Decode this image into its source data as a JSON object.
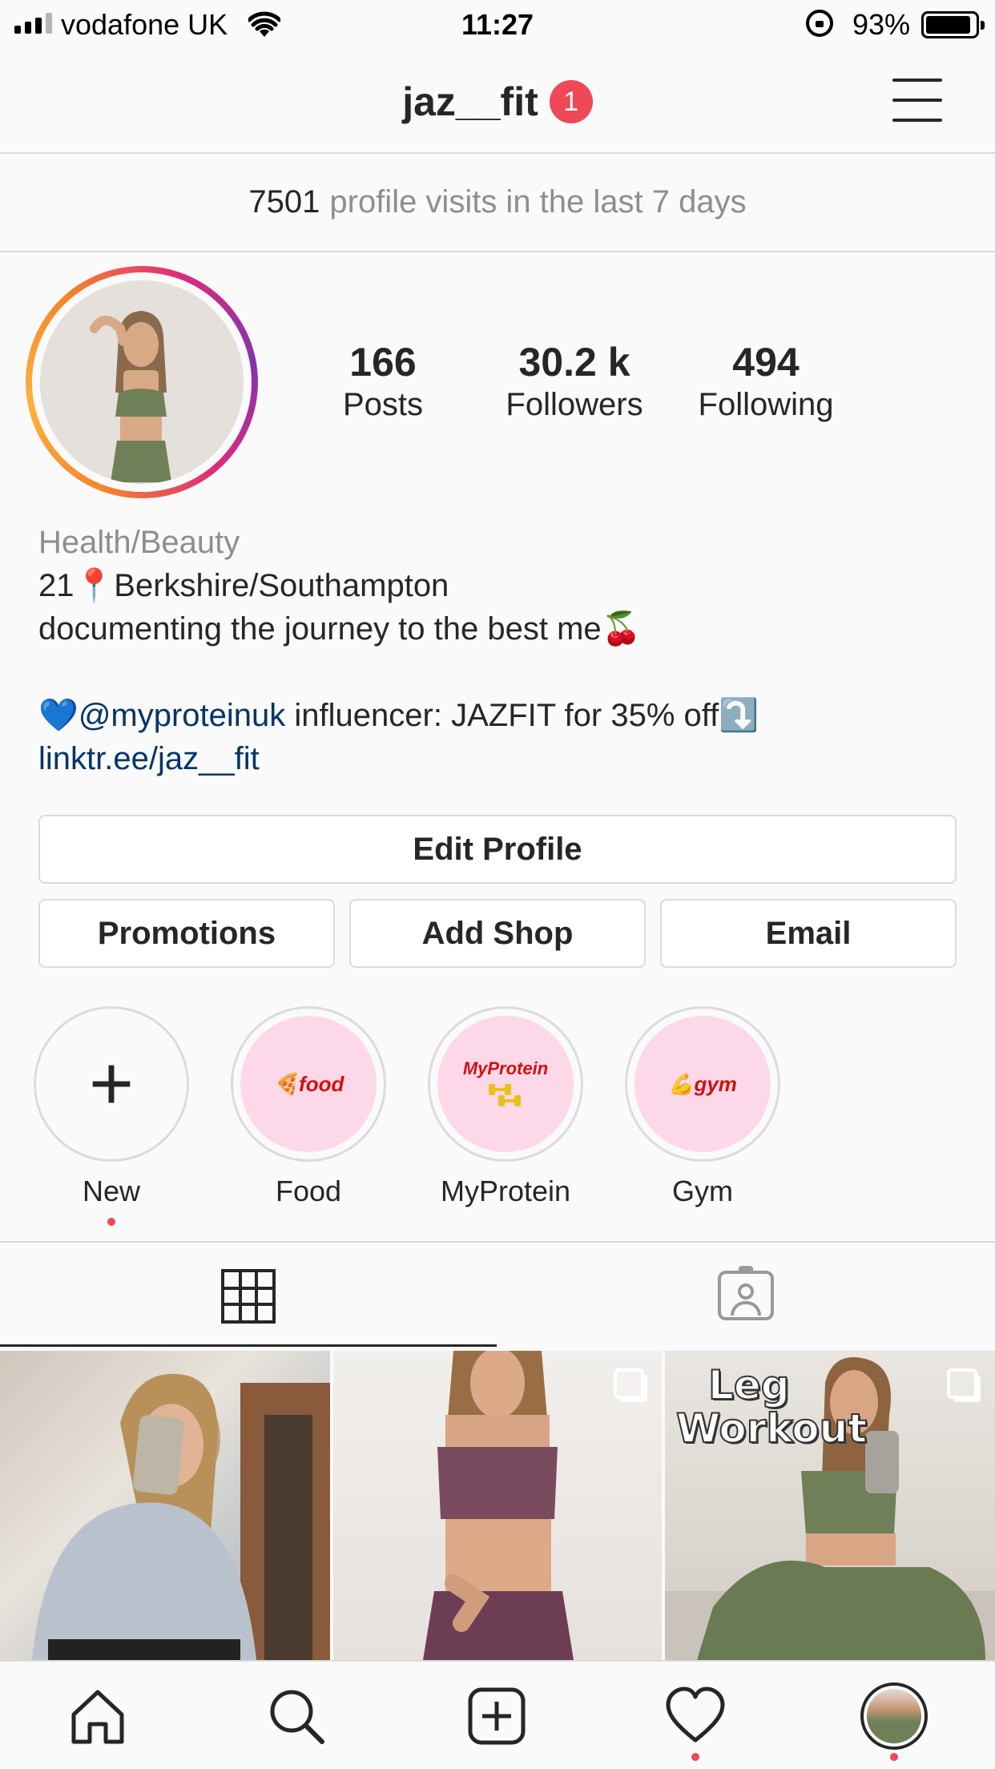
{
  "status_bar": {
    "carrier": "vodafone UK",
    "time": "11:27",
    "battery_percent": "93%",
    "battery_level": 0.93
  },
  "header": {
    "username": "jaz__fit",
    "notification_count": "1"
  },
  "visits_banner": {
    "count": "7501",
    "text": "profile visits in the last 7 days"
  },
  "profile": {
    "stats": [
      {
        "value": "166",
        "label": "Posts"
      },
      {
        "value": "30.2 k",
        "label": "Followers"
      },
      {
        "value": "494",
        "label": "Following"
      }
    ],
    "category": "Health/Beauty",
    "bio_line1": "21📍Berkshire/Southampton",
    "bio_line2": "documenting the journey to the best me🍒",
    "bio_line3_prefix": "💙",
    "bio_mention": "@myproteinuk",
    "bio_line3_suffix": " influencer: JAZFIT for 35% off⤵️",
    "link": "linktr.ee/jaz__fit"
  },
  "buttons": {
    "edit_profile": "Edit Profile",
    "promotions": "Promotions",
    "add_shop": "Add Shop",
    "email": "Email"
  },
  "highlights": [
    {
      "label": "New",
      "icon": "plus-icon"
    },
    {
      "label": "Food",
      "cover_text": "🍕food"
    },
    {
      "label": "MyProtein",
      "cover_text": "MyProtein"
    },
    {
      "label": "Gym",
      "cover_text": "💪gym"
    }
  ],
  "tabs": [
    {
      "name": "grid",
      "icon": "grid-icon",
      "active": true
    },
    {
      "name": "tagged",
      "icon": "tagged-icon",
      "active": false
    }
  ],
  "posts": [
    {
      "overlay_text": "",
      "multiple": false
    },
    {
      "overlay_text": "",
      "multiple": true
    },
    {
      "overlay_text_line1": "Leg",
      "overlay_text_line2": "Workout",
      "multiple": true
    }
  ],
  "bottom_nav": [
    {
      "icon": "home-icon"
    },
    {
      "icon": "search-icon"
    },
    {
      "icon": "add-post-icon"
    },
    {
      "icon": "heart-icon",
      "has_dot": true
    },
    {
      "icon": "profile-avatar-icon",
      "has_dot": true
    }
  ],
  "colors": {
    "badge_red": "#ed4956",
    "link_blue": "#003569",
    "text_dark": "#262626",
    "text_gray": "#8e8e8e",
    "border": "#dbdbdb",
    "highlight_pink": "#fdd8e8"
  }
}
